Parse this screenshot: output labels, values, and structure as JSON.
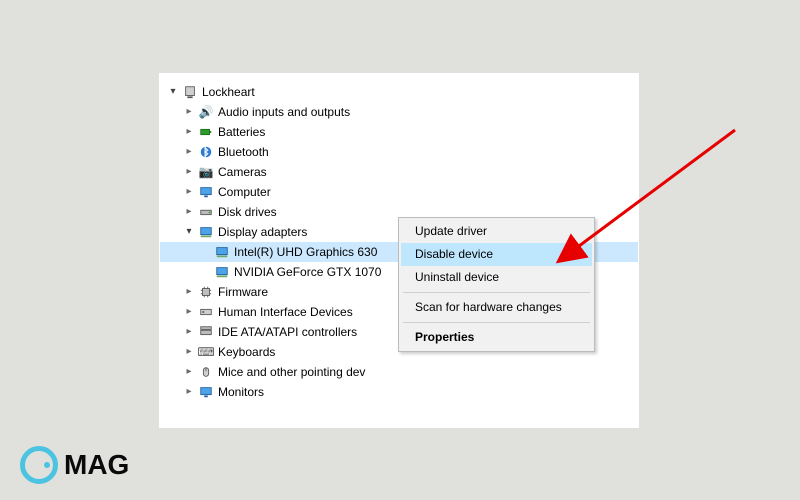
{
  "root": {
    "label": "Lockheart"
  },
  "nodes": {
    "audio": "Audio inputs and outputs",
    "batt": "Batteries",
    "bt": "Bluetooth",
    "cam": "Cameras",
    "comp": "Computer",
    "disk": "Disk drives",
    "disp": "Display adapters",
    "gpu1": "Intel(R) UHD Graphics 630",
    "gpu2": "NVIDIA GeForce GTX 1070",
    "fw": "Firmware",
    "hid": "Human Interface Devices",
    "ide": "IDE ATA/ATAPI controllers",
    "kb": "Keyboards",
    "mouse": "Mice and other pointing dev",
    "mon": "Monitors"
  },
  "menu": {
    "update": "Update driver",
    "disable": "Disable device",
    "uninstall": "Uninstall device",
    "scan": "Scan for hardware changes",
    "props": "Properties"
  },
  "logo": {
    "text": "MAG"
  }
}
